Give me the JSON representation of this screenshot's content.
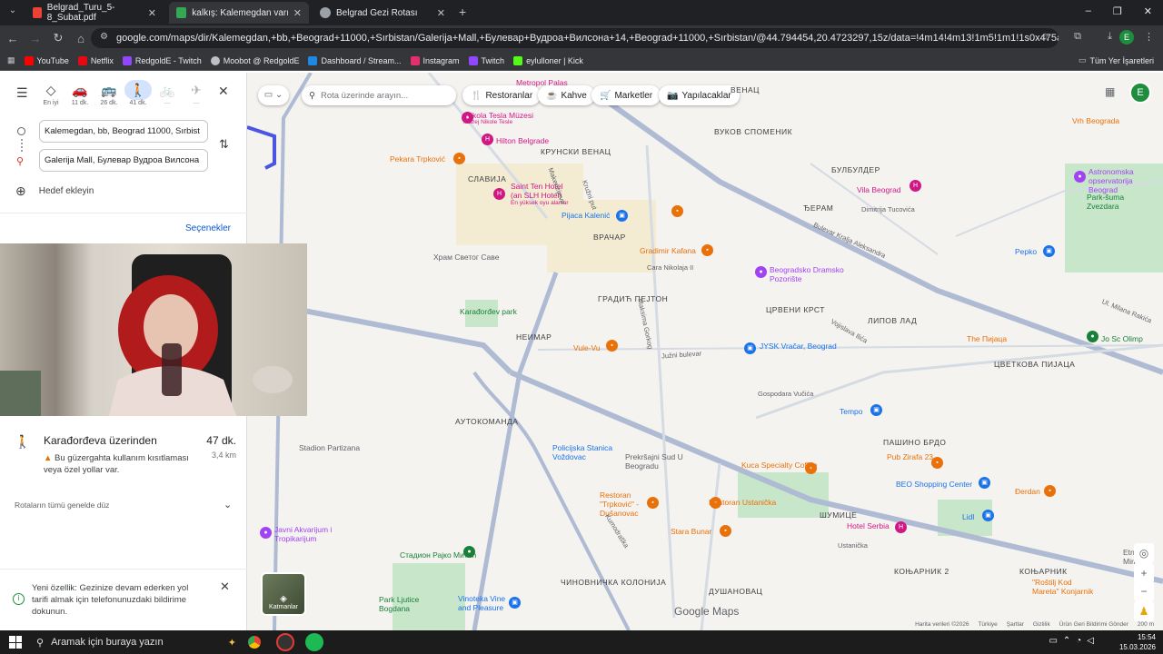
{
  "tabs": [
    {
      "title": "Belgrad_Turu_5-8_Subat.pdf",
      "favicon_color": "#ea4335"
    },
    {
      "title": "kalkış: Kalemegdan varış: Galeri",
      "favicon_color": "#34a853"
    },
    {
      "title": "Belgrad Gezi Rotası",
      "favicon_color": "#9aa0a6"
    }
  ],
  "window_controls": [
    "–",
    "❐",
    "✕"
  ],
  "url": "google.com/maps/dir/Kalemegdan,+bb,+Beograd+11000,+Sırbistan/Galerija+Mall,+Булевар+Вудроа+Вилсона+14,+Beograd+11000,+Sırbistan/@44.794454,20.4723297,15z/data=!4m14!4m13!1m5!1m1!1s0x475a7ab4f7ba19a5:0x29bdf...",
  "bookmarks": [
    {
      "label": "YouTube",
      "color": "#ff0000"
    },
    {
      "label": "Netflix",
      "color": "#e50914"
    },
    {
      "label": "RedgoldE - Twitch",
      "color": "#9146ff"
    },
    {
      "label": "Moobot @ RedgoldE",
      "color": "#bdc1c6"
    },
    {
      "label": "Dashboard / Stream...",
      "color": "#1e88e5"
    },
    {
      "label": "Instagram",
      "color": "#e1306c"
    },
    {
      "label": "Twitch",
      "color": "#9146ff"
    },
    {
      "label": "eylulloner | Kick",
      "color": "#53fc18"
    }
  ],
  "all_bookmarks": "Tüm Yer İşaretleri",
  "sidebar": {
    "modes": [
      {
        "label": "En iyi",
        "icon": "◇"
      },
      {
        "label": "11 dk.",
        "icon": "🚗"
      },
      {
        "label": "26 dk.",
        "icon": "🚌"
      },
      {
        "label": "41 dk.",
        "icon": "🚶"
      },
      {
        "label": "—",
        "icon": "🚲"
      },
      {
        "label": "—",
        "icon": "✈"
      }
    ],
    "origin": "Kalemegdan, bb, Beograd 11000, Sırbist",
    "destination": "Galerija Mall, Булевар Вудроа Вилсона",
    "add_destination": "Hedef ekleyin",
    "options": "Seçenekler",
    "route": {
      "title": "Karađorđeva üzerinden",
      "time": "47 dk.",
      "distance": "3,4 km",
      "warning": "Bu güzergahta kullanım kısıtlaması veya özel yollar var."
    },
    "flat_note": "Rotaların tümü genelde düz",
    "notice": "Yeni özellik: Gezinize devam ederken yol tarifi almak için telefonunuzdaki bildirime dokunun."
  },
  "map": {
    "search_placeholder": "Rota üzerinde arayın...",
    "chips": [
      {
        "label": "Restoranlar",
        "icon": "🍴"
      },
      {
        "label": "Kahve",
        "icon": "☕"
      },
      {
        "label": "Marketler",
        "icon": "🛒"
      },
      {
        "label": "Yapılacaklar",
        "icon": "📷"
      }
    ],
    "districts": [
      "ВРАЧАР",
      "ГРАДИЋ ПЕЈТОН",
      "НЕИМАР",
      "ЦРВЕНИ КРСТ",
      "ЛИПОВ ЛАД",
      "ЦВЕТКОВА ПИЈАЦА",
      "АУТОКОМАНДА",
      "ПАШИНО БРДО",
      "ЧИНОВНИЧКА КОЛОНИЈА",
      "ДУШАНОВАЦ",
      "КОЊАРНИК 2",
      "КОЊАРНИК",
      "ШУМИЦЕ",
      "ВУКОВ СПОМЕНИК",
      "КРУНСКИ ВЕНАЦ",
      "СЛАВИЈА",
      "БУЛБУЛДЕР",
      "ЂЕРАМ",
      "ВЕНАЦ"
    ],
    "pois": [
      "Nikola Tesla Müzesi",
      "Hilton Belgrade",
      "Saint Ten Hotel (an SLH Hotel)",
      "En yüksek oyu alanlar",
      "Pijaca Kalenić",
      "Gradimir Kafana",
      "Храм Светог Саве",
      "Karađorđev park",
      "Beogradsko Dramsko Pozorište",
      "JYSK Vračar, Beograd",
      "Vule-Vu",
      "Tempo",
      "Pub Zirafa 23",
      "Kuca Specialty Coffee",
      "BEO Shopping Center",
      "Restoran Ustanička",
      "Hotel Serbia",
      "Stara Bunar",
      "Restoran \"Trpković\" - Dušanovac",
      "Stadion Partizana",
      "Стадион Рајко Митић",
      "Vinoteka Vine and Pleasure",
      "Javni Akvarijum i Tropikarijum",
      "Pekara Trpković",
      "Vila Beograd",
      "Astronomska opservatorija Beograd",
      "Park-šuma Zvezdara",
      "Pepko",
      "Đerdan",
      "Lidl",
      "Prekršajni Sud U Beogradu",
      "Policijska Stanica Voždovac",
      "Muzej Nikole Tesle",
      "Metropol Palas",
      "Vrh Beograda",
      "\"Roštilj Kod Mareta\" Konjarnik",
      "The Пијаца",
      "Jo Sc Olimp",
      "Ul. Milana Rakića",
      "Park Ljutice Bogdana",
      "Etno Tr Miris"
    ],
    "roads": [
      "Bulevar Kralja Aleksandra",
      "Južni bulevar",
      "Vojislava Ilića",
      "Ustanička",
      "Kumodraška",
      "Cara Nikolaja II",
      "Maksima Gorkog",
      "Dimitrija Tucovića",
      "Gospodara Vučića",
      "Kružni put",
      "Makenzijeva"
    ],
    "layers_label": "Katmanlar",
    "brand": "Google Maps",
    "footer": [
      "Harita verileri ©2026",
      "Türkiye",
      "Şartlar",
      "Gizlilik",
      "Ürün Geri Bildirimi Gönder",
      "200 m"
    ],
    "accent": "#0b57d0",
    "route_color": "#4a56e2"
  },
  "taskbar": {
    "search": "Aramak için buraya yazın",
    "time": "15:54",
    "date": "15.03.2026"
  }
}
